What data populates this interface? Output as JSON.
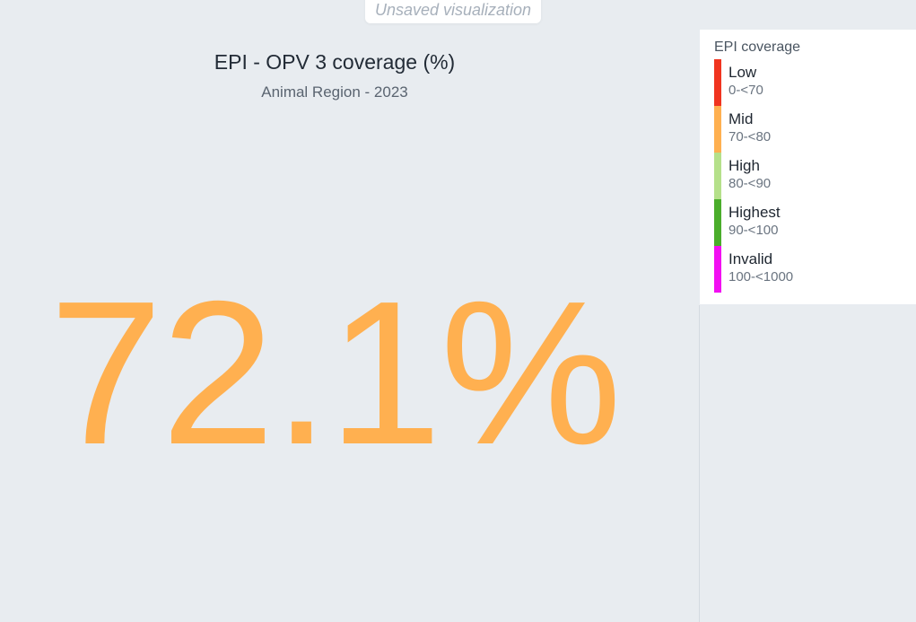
{
  "status": {
    "text": "Unsaved visualization"
  },
  "visualization": {
    "title": "EPI - OPV 3 coverage (%)",
    "subtitle": "Animal Region - 2023",
    "value": "72.1%",
    "value_fraction": 0.721,
    "value_color": "#ffb050"
  },
  "legend": {
    "title": "EPI coverage",
    "items": [
      {
        "label": "Low",
        "range": "0-<70",
        "color": "#f0341f"
      },
      {
        "label": "Mid",
        "range": "70-<80",
        "color": "#ffb050"
      },
      {
        "label": "High",
        "range": "80-<90",
        "color": "#b5e08a"
      },
      {
        "label": "Highest",
        "range": "90-<100",
        "color": "#4aad2b"
      },
      {
        "label": "Invalid",
        "range": "100-<1000",
        "color": "#f20ff2"
      }
    ]
  }
}
